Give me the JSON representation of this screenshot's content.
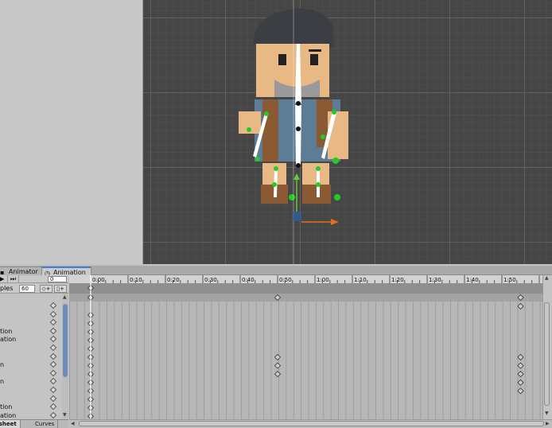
{
  "tabs": {
    "animator": "Animator",
    "animation": "Animation"
  },
  "toolbar": {
    "current_frame": "0",
    "samples_label": "ples",
    "samples_value": "60"
  },
  "timeline": {
    "ticks": [
      "0:00",
      "0:10",
      "0:20",
      "0:30",
      "0:40",
      "0:50",
      "1:00",
      "1:10",
      "1:20",
      "1:30",
      "1:40",
      "1:50"
    ]
  },
  "properties": [
    {
      "label": ""
    },
    {
      "label": ""
    },
    {
      "label": ""
    },
    {
      "label": "tion"
    },
    {
      "label": "ation"
    },
    {
      "label": ""
    },
    {
      "label": ""
    },
    {
      "label": "n"
    },
    {
      "label": ""
    },
    {
      "label": "n"
    },
    {
      "label": ""
    },
    {
      "label": ""
    },
    {
      "label": "tion"
    },
    {
      "label": "ation"
    }
  ],
  "bottom_tabs": {
    "dopesheet": "esheet",
    "curves": "Curves"
  },
  "keyframes": {
    "summary_times": [
      0,
      50,
      115
    ],
    "row_keys": [
      [
        0
      ],
      [
        0
      ],
      [
        0
      ],
      [
        0
      ],
      [
        0
      ],
      [
        0,
        50,
        115
      ],
      [
        0,
        50,
        115
      ],
      [
        0,
        50,
        115
      ],
      [
        0,
        115
      ],
      [
        0,
        115
      ],
      [
        0
      ],
      [
        0
      ],
      [
        0
      ],
      [
        0
      ]
    ]
  },
  "colors": {
    "accent_tab": "#3f7fd6",
    "playhead": "#ffffff",
    "joint_green": "#22cc22",
    "axis_orange": "#e07020",
    "axis_green": "#66cc33"
  }
}
